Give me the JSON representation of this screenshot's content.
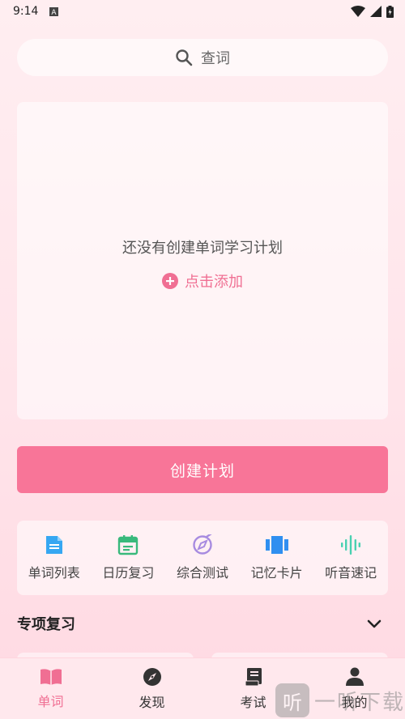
{
  "status_bar": {
    "time": "9:14"
  },
  "search": {
    "placeholder": "查词"
  },
  "plan_card": {
    "empty_text": "还没有创建单词学习计划",
    "add_label": "点击添加"
  },
  "create_button": {
    "label": "创建计划"
  },
  "tools": [
    {
      "label": "单词列表",
      "icon": "document-icon",
      "color": "#36a7f2"
    },
    {
      "label": "日历复习",
      "icon": "calendar-icon",
      "color": "#39b97c"
    },
    {
      "label": "综合测试",
      "icon": "compass-test-icon",
      "color": "#a78be0"
    },
    {
      "label": "记忆卡片",
      "icon": "cards-icon",
      "color": "#2f8ff0"
    },
    {
      "label": "听音速记",
      "icon": "sound-wave-icon",
      "color": "#49d1b1"
    }
  ],
  "section": {
    "title": "专项复习"
  },
  "bottom_nav": [
    {
      "label": "单词",
      "icon": "book-icon",
      "active": true
    },
    {
      "label": "发现",
      "icon": "compass-icon",
      "active": false
    },
    {
      "label": "考试",
      "icon": "exam-icon",
      "active": false
    },
    {
      "label": "我的",
      "icon": "person-icon",
      "active": false
    }
  ],
  "watermark": {
    "glyph": "听",
    "text": "一听下载"
  },
  "colors": {
    "accent": "#f87598",
    "accent_text": "#f06f93"
  }
}
